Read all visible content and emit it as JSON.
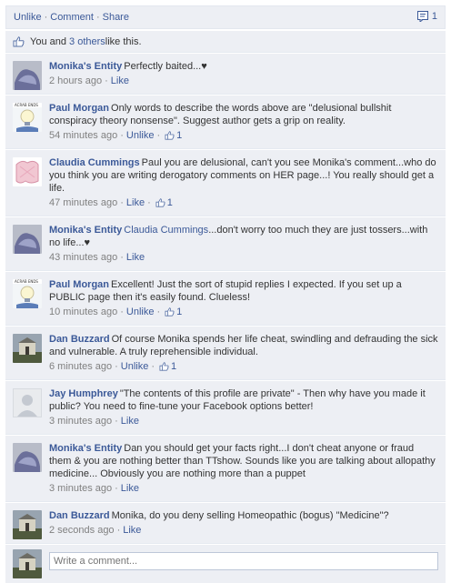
{
  "actions": {
    "unlike": "Unlike",
    "comment": "Comment",
    "share": "Share",
    "comment_count": "1"
  },
  "likes": {
    "prefix": "You and ",
    "others": "3 others",
    "suffix": " like this."
  },
  "comments": [
    {
      "author": "Monika's Entity",
      "avatar": "purple-blob-avatar",
      "tag": "",
      "text": "Perfectly baited...♥",
      "time": "2 hours ago",
      "action": "Like",
      "likes": ""
    },
    {
      "author": "Paul Morgan",
      "avatar": "lightbulb-avatar",
      "tag": "",
      "text": "Only words to describe the words above are \"delusional bullshit conspiracy theory nonsense\". Suggest author gets a grip on reality.",
      "time": "54 minutes ago",
      "action": "Unlike",
      "likes": "1"
    },
    {
      "author": "Claudia Cummings",
      "avatar": "pink-fabric-avatar",
      "tag": "",
      "text": "Paul you are delusional, can't you see Monika's comment...who do you think you are writing derogatory comments on HER page...! You really should get a life.",
      "time": "47 minutes ago",
      "action": "Like",
      "likes": "1"
    },
    {
      "author": "Monika's Entity",
      "avatar": "purple-blob-avatar",
      "tag": "Claudia Cummings",
      "text": "...don't worry too much they are just tossers...with no life...♥",
      "time": "43 minutes ago",
      "action": "Like",
      "likes": ""
    },
    {
      "author": "Paul Morgan",
      "avatar": "lightbulb-avatar",
      "tag": "",
      "text": "Excellent! Just the sort of stupid replies I expected. If you set up a PUBLIC page then it's easily found. Clueless!",
      "time": "10 minutes ago",
      "action": "Unlike",
      "likes": "1"
    },
    {
      "author": "Dan Buzzard",
      "avatar": "building-avatar",
      "tag": "",
      "text": "Of course Monika spends her life cheat, swindling and defrauding the sick and vulnerable. A truly reprehensible individual.",
      "time": "6 minutes ago",
      "action": "Unlike",
      "likes": "1"
    },
    {
      "author": "Jay Humphrey",
      "avatar": "default-silhouette-avatar",
      "tag": "",
      "text": "\"The contents of this profile are private\" - Then why have you made it public? You need to fine-tune your Facebook options better!",
      "time": "3 minutes ago",
      "action": "Like",
      "likes": ""
    },
    {
      "author": "Monika's Entity",
      "avatar": "purple-blob-avatar",
      "tag": "",
      "text": "Dan you should get your facts right...I don't cheat anyone or fraud them & you are nothing better than TTshow. Sounds like you are talking about allopathy medicine... Obviously you are nothing more than a puppet",
      "time": "3 minutes ago",
      "action": "Like",
      "likes": ""
    },
    {
      "author": "Dan Buzzard",
      "avatar": "building-avatar",
      "tag": "",
      "text": "Monika, do you deny selling Homeopathic (bogus) \"Medicine\"?",
      "time": "2 seconds ago",
      "action": "Like",
      "likes": ""
    }
  ],
  "composer": {
    "placeholder": "Write a comment..."
  }
}
